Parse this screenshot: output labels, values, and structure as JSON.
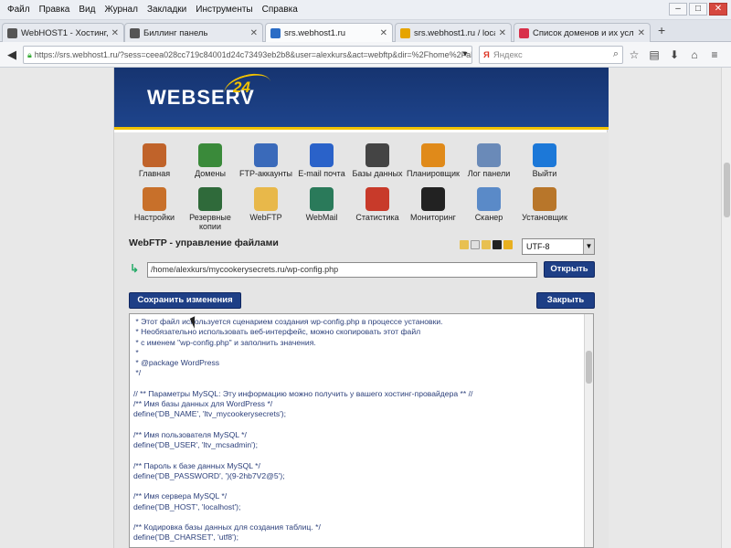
{
  "menu": [
    "Файл",
    "Правка",
    "Вид",
    "Журнал",
    "Закладки",
    "Инструменты",
    "Справка"
  ],
  "tabs": [
    {
      "label": "WebHOST1 - Хостинг, рег...",
      "icon_color": "#555"
    },
    {
      "label": "Биллинг панель",
      "icon_color": "#555"
    },
    {
      "label": "srs.webhost1.ru",
      "icon_color": "#2a6cc5",
      "active": true
    },
    {
      "label": "srs.webhost1.ru / localhost...",
      "icon_color": "#e6a400"
    },
    {
      "label": "Список доменов и их усл...",
      "icon_color": "#d8304a"
    }
  ],
  "url": "https://srs.webhost1.ru/?sess=ceea028cc719c84001d24c73493eb2b8&user=alexkurs&act=webftp&dir=%2Fhome%2Falexkurs%",
  "search_placeholder": "Яндекс",
  "logo": {
    "main": "WEBSERV",
    "sub": "24"
  },
  "icons": [
    {
      "label": "Главная",
      "name": "home-icon",
      "color": "#c0632a"
    },
    {
      "label": "Домены",
      "name": "globe-icon",
      "color": "#3a8a3a"
    },
    {
      "label": "FTP-аккаунты",
      "name": "network-icon",
      "color": "#3a6aba"
    },
    {
      "label": "E-mail почта",
      "name": "at-icon",
      "color": "#2a62c9"
    },
    {
      "label": "Базы данных",
      "name": "database-icon",
      "color": "#444"
    },
    {
      "label": "Планировщик",
      "name": "alarm-clock-icon",
      "color": "#e08a1a"
    },
    {
      "label": "Лог панели",
      "name": "log-icon",
      "color": "#6a8ab8"
    },
    {
      "label": "Выйти",
      "name": "power-icon",
      "color": "#1c78d8"
    },
    {
      "label": "Настройки",
      "name": "users-icon",
      "color": "#c8702a"
    },
    {
      "label": "Резервные копии",
      "name": "books-icon",
      "color": "#2f6a3a"
    },
    {
      "label": "WebFTP",
      "name": "folder-icon",
      "color": "#e8b84a"
    },
    {
      "label": "WebMail",
      "name": "webmail-globe-icon",
      "color": "#2a7a5a"
    },
    {
      "label": "Статистика",
      "name": "chart-icon",
      "color": "#c83a2a"
    },
    {
      "label": "Мониторинг",
      "name": "monitor-icon",
      "color": "#222"
    },
    {
      "label": "Сканер",
      "name": "shield-icon",
      "color": "#5a8ac8"
    },
    {
      "label": "Установщик",
      "name": "box-icon",
      "color": "#b8762a"
    }
  ],
  "page_title": "WebFTP - управление файлами",
  "encoding": "UTF-8",
  "path": "/home/alexkurs/mycookerysecrets.ru/wp-config.php",
  "open_label": "Открыть",
  "save_label": "Сохранить изменения",
  "close_label": "Закрыть",
  "code_lines": [
    " * Этот файл используется сценарием создания wp-config.php в процессе установки.",
    " * Необязательно использовать веб-интерфейс, можно скопировать этот файл",
    " * с именем \"wp-config.php\" и заполнить значения.",
    " *",
    " * @package WordPress",
    " */",
    "",
    "// ** Параметры MySQL: Эту информацию можно получить у вашего хостинг-провайдера ** //",
    "/** Имя базы данных для WordPress */",
    "define('DB_NAME', 'ltv_mycookerysecrets');",
    "",
    "/** Имя пользователя MySQL */",
    "define('DB_USER', 'ltv_mcsadmin');",
    "",
    "/** Пароль к базе данных MySQL */",
    "define('DB_PASSWORD', ')(9-2hb7V2@5');",
    "",
    "/** Имя сервера MySQL */",
    "define('DB_HOST', 'localhost');",
    "",
    "/** Кодировка базы данных для создания таблиц. */",
    "define('DB_CHARSET', 'utf8');"
  ]
}
